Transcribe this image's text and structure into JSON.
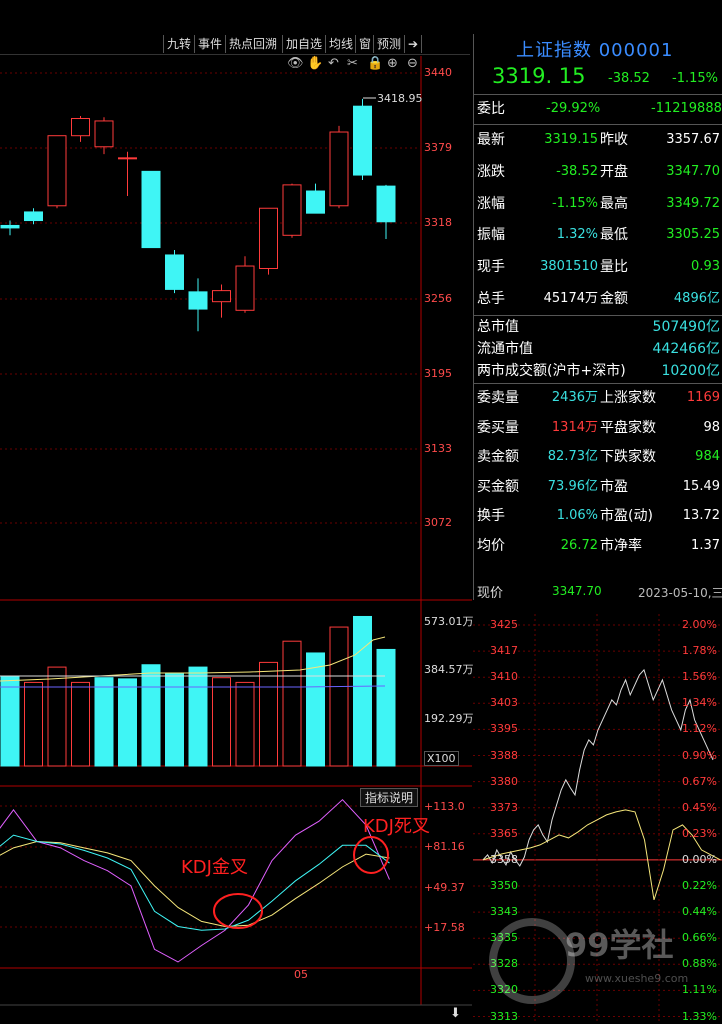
{
  "toolbar": {
    "buttons": [
      "九转",
      "事件",
      "热点回溯",
      "加自选",
      "均线",
      "窗",
      "预测"
    ],
    "icons": [
      "eye-icon",
      "hand-icon",
      "undo-icon",
      "scissors-icon",
      "lock-icon",
      "zoom-in-icon",
      "zoom-out-icon"
    ]
  },
  "kline": {
    "y_ticks": [
      "3440",
      "3379",
      "3318",
      "3256",
      "3195",
      "3133",
      "3072"
    ],
    "high_marker": "3418.95",
    "candles": [
      {
        "o": 3316,
        "h": 3320,
        "l": 3308,
        "c": 3314
      },
      {
        "o": 3327,
        "h": 3330,
        "l": 3317,
        "c": 3320
      },
      {
        "o": 3332,
        "h": 3386,
        "l": 3330,
        "c": 3389
      },
      {
        "o": 3389,
        "h": 3405,
        "l": 3384,
        "c": 3403
      },
      {
        "o": 3380,
        "h": 3404,
        "l": 3374,
        "c": 3401
      },
      {
        "o": 3371,
        "h": 3376,
        "l": 3340,
        "c": 3371
      },
      {
        "o": 3360,
        "h": 3357,
        "l": 3308,
        "c": 3298
      },
      {
        "o": 3292,
        "h": 3296,
        "l": 3261,
        "c": 3264
      },
      {
        "o": 3262,
        "h": 3273,
        "l": 3230,
        "c": 3248
      },
      {
        "o": 3254,
        "h": 3268,
        "l": 3241,
        "c": 3263
      },
      {
        "o": 3247,
        "h": 3291,
        "l": 3245,
        "c": 3283
      },
      {
        "o": 3281,
        "h": 3330,
        "l": 3276,
        "c": 3330
      },
      {
        "o": 3308,
        "h": 3350,
        "l": 3306,
        "c": 3349
      },
      {
        "o": 3344,
        "h": 3350,
        "l": 3326,
        "c": 3326
      },
      {
        "o": 3332,
        "h": 3397,
        "l": 3330,
        "c": 3392
      },
      {
        "o": 3413,
        "h": 3419,
        "l": 3353,
        "c": 3357
      },
      {
        "o": 3348,
        "h": 3349,
        "l": 3305,
        "c": 3319
      }
    ],
    "colors": {
      "up": "#ff3b3b",
      "down": "#3ff5f5",
      "axis": "#b00000"
    }
  },
  "volume": {
    "y_ticks": [
      "573.01万",
      "384.57万",
      "192.29万"
    ],
    "unit": "X100",
    "bars": [
      {
        "v": 380,
        "up": false
      },
      {
        "v": 355,
        "up": true
      },
      {
        "v": 420,
        "up": true
      },
      {
        "v": 355,
        "up": true
      },
      {
        "v": 375,
        "up": false
      },
      {
        "v": 370,
        "up": false
      },
      {
        "v": 430,
        "up": false
      },
      {
        "v": 395,
        "up": false
      },
      {
        "v": 420,
        "up": false
      },
      {
        "v": 375,
        "up": true
      },
      {
        "v": 355,
        "up": true
      },
      {
        "v": 440,
        "up": true
      },
      {
        "v": 530,
        "up": true
      },
      {
        "v": 480,
        "up": false
      },
      {
        "v": 590,
        "up": true
      },
      {
        "v": 635,
        "up": false
      },
      {
        "v": 495,
        "up": false
      }
    ]
  },
  "kdj": {
    "button": "指标说明",
    "y_ticks": [
      "+113.0",
      "+81.16",
      "+49.37",
      "+17.58"
    ],
    "x_label": "05",
    "golden_cross": "KDJ金叉",
    "death_cross": "KDJ死叉",
    "k": [
      75,
      90,
      85,
      83,
      78,
      72,
      63,
      30,
      18,
      15,
      16,
      23,
      38,
      54,
      67,
      82,
      82,
      68
    ],
    "d": [
      70,
      80,
      85,
      84,
      80,
      76,
      70,
      50,
      33,
      22,
      18,
      19,
      27,
      40,
      52,
      65,
      75,
      72
    ],
    "j": [
      85,
      110,
      85,
      80,
      70,
      62,
      50,
      0,
      -10,
      3,
      15,
      35,
      70,
      90,
      101,
      118,
      98,
      55
    ]
  },
  "quote": {
    "title": "上证指数 000001",
    "price": "3319. 15",
    "change": "-38.52",
    "change_pct": "-1.15%",
    "weibi_label": "委比",
    "weibi_pct": "-29.92%",
    "weibi_val": "-11219888",
    "rows": [
      {
        "l1": "最新",
        "v1": "3319.15",
        "c1": "green",
        "l2": "昨收",
        "v2": "3357.67",
        "c2": "white"
      },
      {
        "l1": "涨跌",
        "v1": "-38.52",
        "c1": "green",
        "l2": "开盘",
        "v2": "3347.70",
        "c2": "green"
      },
      {
        "l1": "涨幅",
        "v1": "-1.15%",
        "c1": "green",
        "l2": "最高",
        "v2": "3349.72",
        "c2": "green"
      },
      {
        "l1": "振幅",
        "v1": "1.32%",
        "c1": "cyan",
        "l2": "最低",
        "v2": "3305.25",
        "c2": "green"
      },
      {
        "l1": "现手",
        "v1": "3801510",
        "c1": "cyan",
        "l2": "量比",
        "v2": "0.93",
        "c2": "green"
      },
      {
        "l1": "总手",
        "v1": "45174万",
        "c1": "white",
        "l2": "金额",
        "v2": "4896亿",
        "c2": "cyan"
      }
    ],
    "mv": [
      {
        "l": "总市值",
        "v": "507490亿"
      },
      {
        "l": "流通市值",
        "v": "442466亿"
      },
      {
        "l": "两市成交额(沪市+深市)",
        "v": "10200亿"
      }
    ],
    "rows2": [
      {
        "l1": "委卖量",
        "v1": "2436万",
        "c1": "cyan",
        "l2": "上涨家数",
        "v2": "1169",
        "c2": "red"
      },
      {
        "l1": "委买量",
        "v1": "1314万",
        "c1": "red",
        "l2": "平盘家数",
        "v2": "98",
        "c2": "white"
      },
      {
        "l1": "卖金额",
        "v1": "82.73亿",
        "c1": "cyan",
        "l2": "下跌家数",
        "v2": "984",
        "c2": "green"
      },
      {
        "l1": "买金额",
        "v1": "73.96亿",
        "c1": "cyan",
        "l2": "市盈",
        "v2": "15.49",
        "c2": "white"
      },
      {
        "l1": "换手",
        "v1": "1.06%",
        "c1": "cyan",
        "l2": "市盈(动)",
        "v2": "13.72",
        "c2": "white"
      },
      {
        "l1": "均价",
        "v1": "26.72",
        "c1": "green",
        "l2": "市净率",
        "v2": "1.37",
        "c2": "white"
      }
    ]
  },
  "timeline": {
    "current_label": "现价",
    "current_value": "3347.70",
    "date": "2023-05-10,三",
    "left_ticks": [
      "3425",
      "3417",
      "3410",
      "3403",
      "3395",
      "3388",
      "3380",
      "3373",
      "3365",
      "3358",
      "3350",
      "3343",
      "3335",
      "3328",
      "3320",
      "3313"
    ],
    "right_ticks": [
      "2.00%",
      "1.78%",
      "1.56%",
      "1.34%",
      "1.12%",
      "0.90%",
      "0.67%",
      "0.45%",
      "0.23%",
      "0.00%",
      "0.22%",
      "0.44%",
      "0.66%",
      "0.88%",
      "1.11%",
      "1.33%"
    ]
  },
  "watermark": "99学社",
  "watermark_url": "www.xueshe9.com"
}
